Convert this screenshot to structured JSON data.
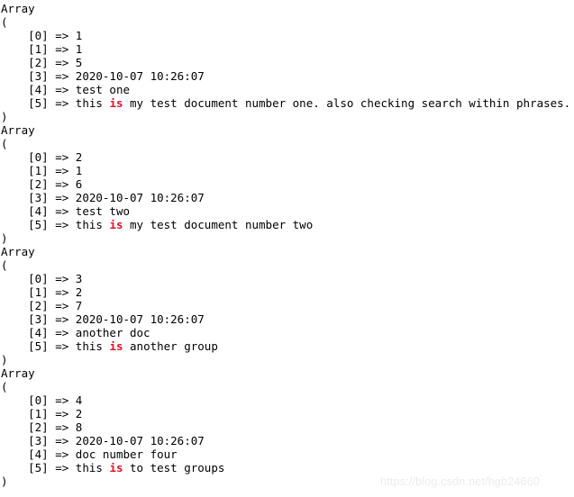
{
  "console": {
    "array_header": "Array",
    "open_paren": "(",
    "close_paren": ")",
    "indent": "    ",
    "arrow": " => ",
    "highlight_word": "is",
    "highlight_color": "#ea0f2a",
    "text_color": "#000000",
    "background_color": "#ffffff",
    "blocks": [
      {
        "header": "Array",
        "open": "(",
        "close": ")",
        "rows": [
          {
            "key": "[0]",
            "arrow": " => ",
            "value": "1"
          },
          {
            "key": "[1]",
            "arrow": " => ",
            "value": "1"
          },
          {
            "key": "[2]",
            "arrow": " => ",
            "value": "5"
          },
          {
            "key": "[3]",
            "arrow": " => ",
            "value": "2020-10-07 10:26:07"
          },
          {
            "key": "[4]",
            "arrow": " => ",
            "value": "test one"
          },
          {
            "key": "[5]",
            "arrow": " => ",
            "pre": "this ",
            "hl": "is",
            "post": " my test document number one. also checking search within phrases."
          }
        ]
      },
      {
        "header": "Array",
        "open": "(",
        "close": ")",
        "rows": [
          {
            "key": "[0]",
            "arrow": " => ",
            "value": "2"
          },
          {
            "key": "[1]",
            "arrow": " => ",
            "value": "1"
          },
          {
            "key": "[2]",
            "arrow": " => ",
            "value": "6"
          },
          {
            "key": "[3]",
            "arrow": " => ",
            "value": "2020-10-07 10:26:07"
          },
          {
            "key": "[4]",
            "arrow": " => ",
            "value": "test two"
          },
          {
            "key": "[5]",
            "arrow": " => ",
            "pre": "this ",
            "hl": "is",
            "post": " my test document number two"
          }
        ]
      },
      {
        "header": "Array",
        "open": "(",
        "close": ")",
        "rows": [
          {
            "key": "[0]",
            "arrow": " => ",
            "value": "3"
          },
          {
            "key": "[1]",
            "arrow": " => ",
            "value": "2"
          },
          {
            "key": "[2]",
            "arrow": " => ",
            "value": "7"
          },
          {
            "key": "[3]",
            "arrow": " => ",
            "value": "2020-10-07 10:26:07"
          },
          {
            "key": "[4]",
            "arrow": " => ",
            "value": "another doc"
          },
          {
            "key": "[5]",
            "arrow": " => ",
            "pre": "this ",
            "hl": "is",
            "post": " another group"
          }
        ]
      },
      {
        "header": "Array",
        "open": "(",
        "close": ")",
        "rows": [
          {
            "key": "[0]",
            "arrow": " => ",
            "value": "4"
          },
          {
            "key": "[1]",
            "arrow": " => ",
            "value": "2"
          },
          {
            "key": "[2]",
            "arrow": " => ",
            "value": "8"
          },
          {
            "key": "[3]",
            "arrow": " => ",
            "value": "2020-10-07 10:26:07"
          },
          {
            "key": "[4]",
            "arrow": " => ",
            "value": "doc number four"
          },
          {
            "key": "[5]",
            "arrow": " => ",
            "pre": "this ",
            "hl": "is",
            "post": " to test groups"
          }
        ]
      }
    ]
  },
  "watermark": {
    "text": "https://blog.csdn.net/hgb24660"
  }
}
